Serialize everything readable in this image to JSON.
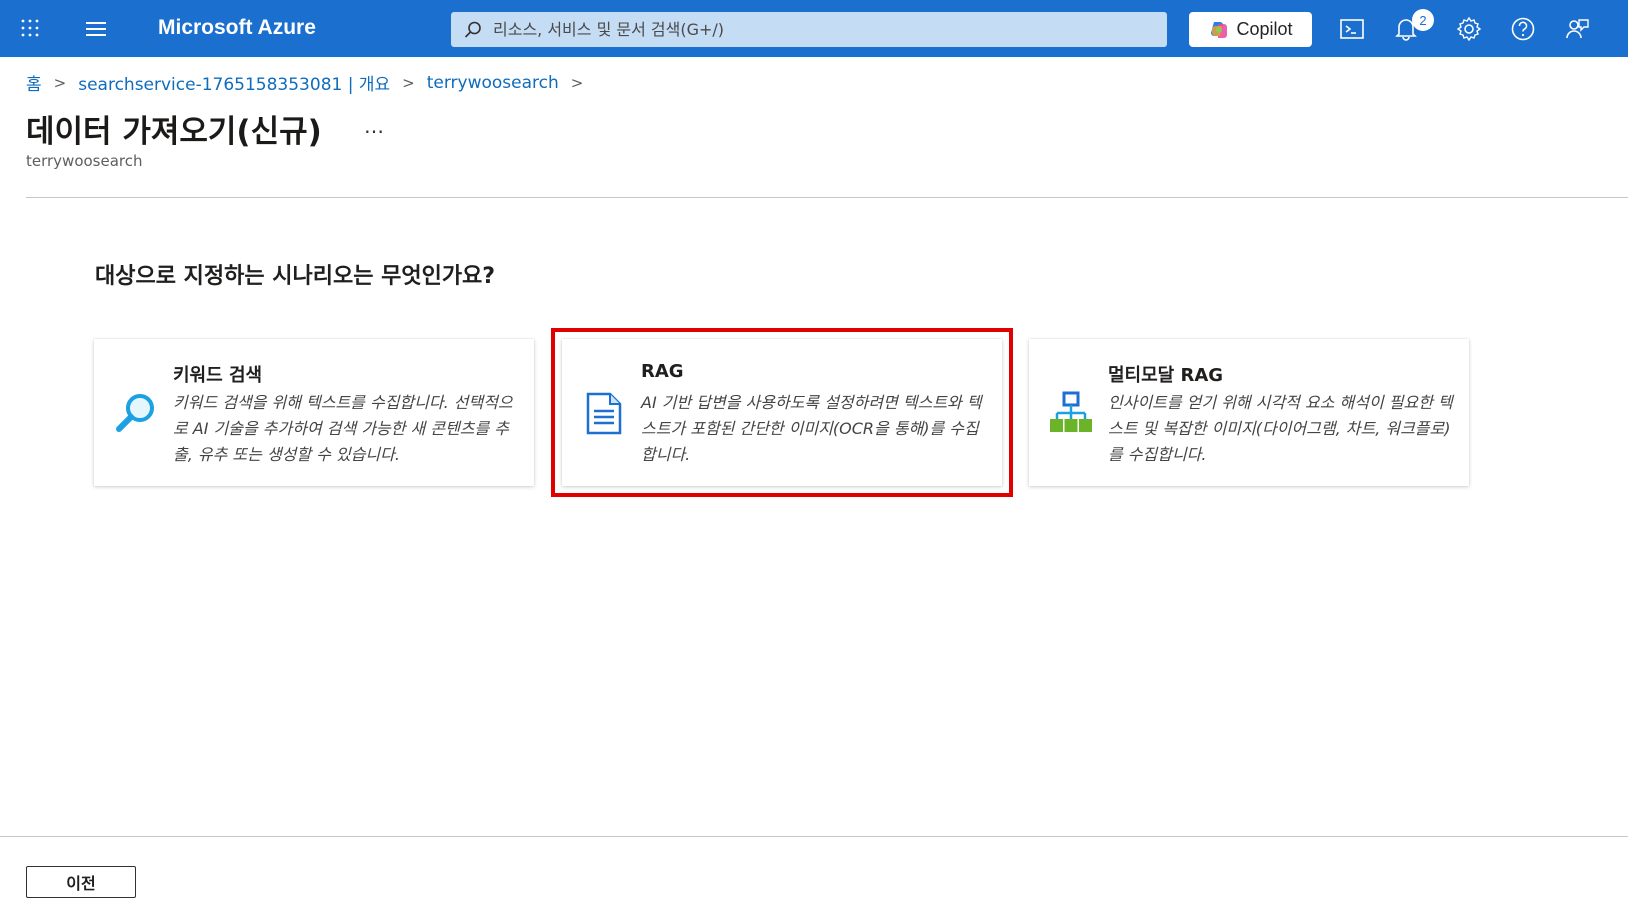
{
  "topbar": {
    "brand": "Microsoft Azure",
    "search_placeholder": "리소스, 서비스 및 문서 검색(G+/)",
    "copilot_label": "Copilot",
    "notification_count": "2",
    "bg_color": "#1a6fcf"
  },
  "breadcrumb": {
    "items": [
      "홈",
      "searchservice-1765158353081 | 개요",
      "terrywoosearch"
    ]
  },
  "header": {
    "title": "데이터 가져오기(신규)",
    "more": "…",
    "subtitle": "terrywoosearch"
  },
  "main": {
    "question": "대상으로 지정하는 시나리오는 무엇인가요?",
    "cards": [
      {
        "title": "키워드 검색",
        "description": "키워드 검색을 위해 텍스트를 수집합니다. 선택적으로 AI 기술을 추가하여 검색 가능한 새 콘텐츠를 추출, 유추 또는 생성할 수 있습니다.",
        "icon": "magnifier-icon"
      },
      {
        "title": "RAG",
        "description": "AI 기반 답변을 사용하도록 설정하려면 텍스트와 텍스트가 포함된 간단한 이미지(OCR을 통해)를 수집합니다.",
        "icon": "document-icon"
      },
      {
        "title": "멀티모달 RAG",
        "description": "인사이트를 얻기 위해 시각적 요소 해석이 필요한 텍스트 및 복잡한 이미지(다이어그램, 차트, 워크플로)를 수집합니다.",
        "icon": "hierarchy-icon"
      }
    ],
    "highlight_color": "#e00000"
  },
  "footer": {
    "prev_label": "이전"
  }
}
